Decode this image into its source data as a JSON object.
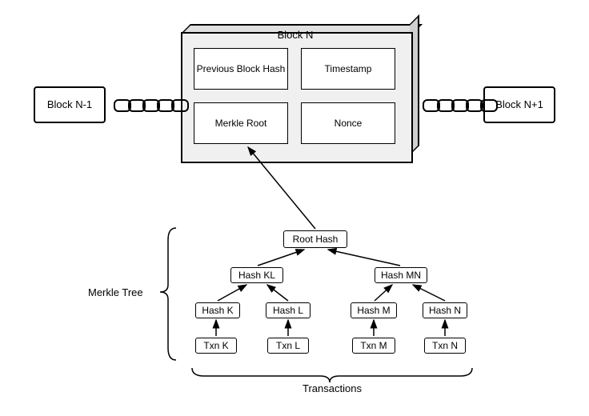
{
  "blocks": {
    "prev": "Block N-1",
    "current": "Block N",
    "next": "Block N+1"
  },
  "header": {
    "prev_hash": "Previous Block Hash",
    "timestamp": "Timestamp",
    "merkle_root": "Merkle Root",
    "nonce": "Nonce"
  },
  "tree": {
    "label": "Merkle Tree",
    "root": "Root Hash",
    "hash_kl": "Hash KL",
    "hash_mn": "Hash MN",
    "hash_k": "Hash K",
    "hash_l": "Hash L",
    "hash_m": "Hash M",
    "hash_n": "Hash N",
    "txn_k": "Txn K",
    "txn_l": "Txn L",
    "txn_m": "Txn M",
    "txn_n": "Txn N"
  },
  "transactions_label": "Transactions"
}
